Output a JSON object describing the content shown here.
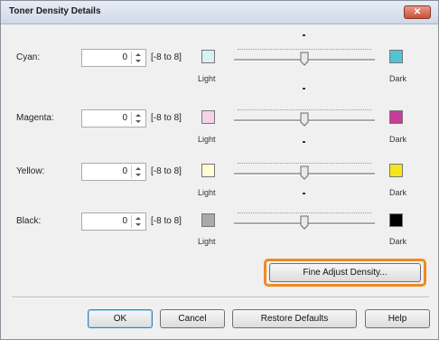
{
  "window": {
    "title": "Toner Density Details",
    "close_label": "✕"
  },
  "rows": [
    {
      "label": "Cyan:",
      "value": "0",
      "range": "[-8 to 8]",
      "light": "Light",
      "dark": "Dark",
      "light_color": "#d8f0f7",
      "dark_color": "#52c3d5",
      "slider_value": 0
    },
    {
      "label": "Magenta:",
      "value": "0",
      "range": "[-8 to 8]",
      "light": "Light",
      "dark": "Dark",
      "light_color": "#f3d3e6",
      "dark_color": "#c73c98",
      "slider_value": 0
    },
    {
      "label": "Yellow:",
      "value": "0",
      "range": "[-8 to 8]",
      "light": "Light",
      "dark": "Dark",
      "light_color": "#fffbd6",
      "dark_color": "#f6e51a",
      "slider_value": 0
    },
    {
      "label": "Black:",
      "value": "0",
      "range": "[-8 to 8]",
      "light": "Light",
      "dark": "Dark",
      "light_color": "#a9a9a9",
      "dark_color": "#000000",
      "slider_value": 0
    }
  ],
  "buttons": {
    "fine_adjust": "Fine Adjust Density...",
    "ok": "OK",
    "cancel": "Cancel",
    "restore": "Restore Defaults",
    "help": "Help"
  },
  "colors": {
    "highlight": "#f08a24"
  }
}
